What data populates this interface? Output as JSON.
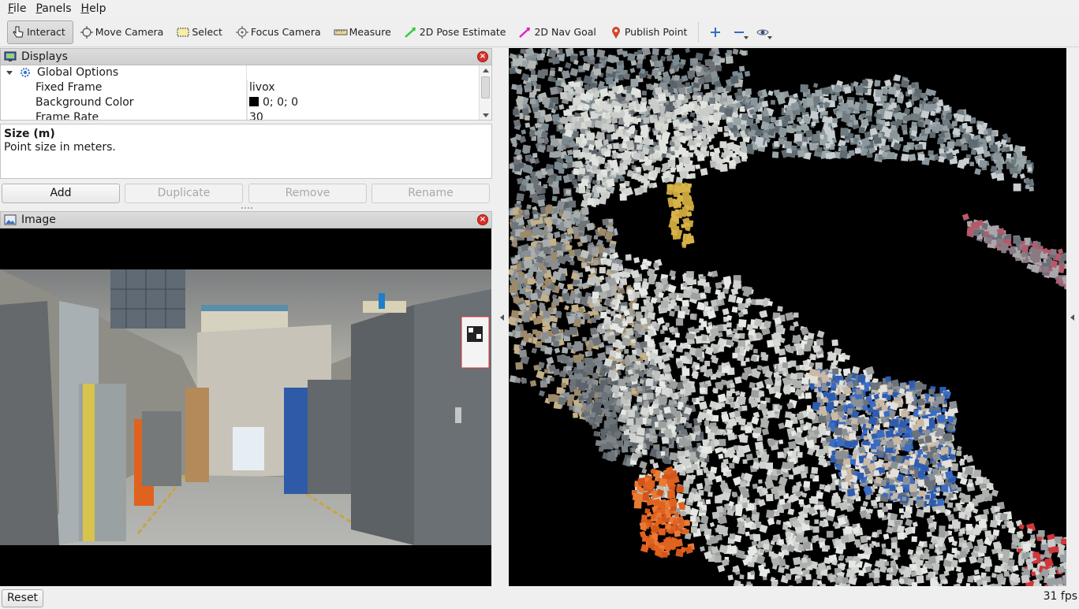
{
  "menubar": {
    "items": [
      {
        "label": "File",
        "mnemonic": "F",
        "rest": "ile"
      },
      {
        "label": "Panels",
        "mnemonic": "P",
        "rest": "anels"
      },
      {
        "label": "Help",
        "mnemonic": "H",
        "rest": "elp"
      }
    ]
  },
  "toolbar": {
    "interact": "Interact",
    "move_camera": "Move Camera",
    "select": "Select",
    "focus_camera": "Focus Camera",
    "measure": "Measure",
    "pose_estimate": "2D Pose Estimate",
    "nav_goal": "2D Nav Goal",
    "publish_point": "Publish Point",
    "colors": {
      "pose": "#2ecc40",
      "nav": "#e020c8",
      "pin": "#d2472c",
      "plus": "#2d6fc2"
    }
  },
  "displays": {
    "title": "Displays",
    "rows": [
      {
        "label": "Global Options",
        "value": ""
      },
      {
        "label": "Fixed Frame",
        "value": "livox"
      },
      {
        "label": "Background Color",
        "value": "0; 0; 0"
      },
      {
        "label": "Frame Rate",
        "value": "30"
      }
    ],
    "description_title": "Size (m)",
    "description_text": "Point size in meters.",
    "buttons": {
      "add": "Add",
      "duplicate": "Duplicate",
      "remove": "Remove",
      "rename": "Rename"
    }
  },
  "image_panel": {
    "title": "Image"
  },
  "status": {
    "reset": "Reset",
    "fps": "31 fps"
  }
}
